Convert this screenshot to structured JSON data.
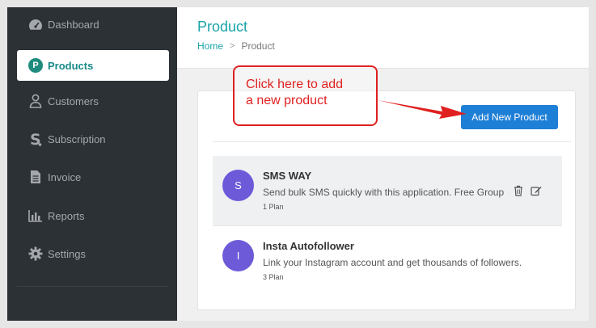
{
  "sidebar": {
    "items": [
      {
        "label": "Dashboard",
        "icon": "dashboard-icon"
      },
      {
        "label": "Products",
        "icon": "products-p-icon",
        "active": true
      },
      {
        "label": "Customers",
        "icon": "user-icon"
      },
      {
        "label": "Subscription",
        "icon": "subscription-s-icon"
      },
      {
        "label": "Invoice",
        "icon": "document-icon"
      },
      {
        "label": "Reports",
        "icon": "bar-chart-icon"
      },
      {
        "label": "Settings",
        "icon": "gear-icon"
      }
    ],
    "products_badge": "P"
  },
  "header": {
    "title": "Product",
    "breadcrumb": {
      "home": "Home",
      "separator": ">",
      "current": "Product"
    }
  },
  "toolbar": {
    "add_label": "Add New Product"
  },
  "products": [
    {
      "initial": "S",
      "name": "SMS WAY",
      "description": "Send bulk SMS quickly with this application. Free Group",
      "plan": "1 Plan"
    },
    {
      "initial": "I",
      "name": "Insta Autofollower",
      "description": "Link your Instagram account and get thousands of followers.",
      "plan": "3 Plan"
    }
  ],
  "annotation": {
    "text": "Click here to add\na new product"
  },
  "colors": {
    "sidebar_bg": "#2c3136",
    "accent_teal": "#1aa3a8",
    "button_blue": "#1e7fd6",
    "avatar_purple": "#6c5ad8",
    "annotation_red": "#e02020"
  }
}
